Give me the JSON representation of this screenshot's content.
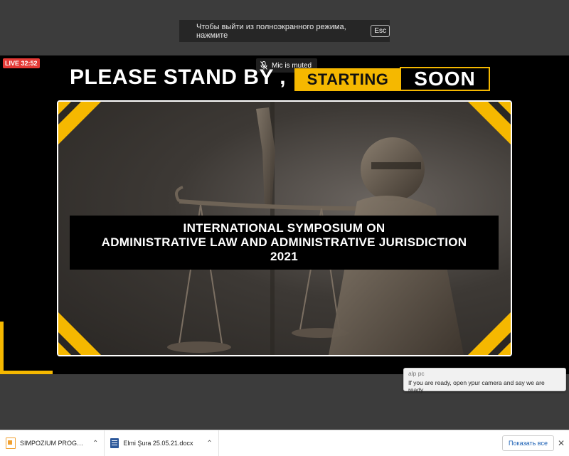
{
  "fullscreen_banner": {
    "text": "Чтобы выйти из полноэкранного режима, нажмите",
    "key": "Esc"
  },
  "stream": {
    "live_badge": "LIVE 32:52",
    "mic_status": "Mic is muted",
    "headline_left": "PLEASE STAND BY ,",
    "headline_starting": "STARTING",
    "headline_soon": "SOON",
    "title_lines": [
      "INTERNATIONAL SYMPOSIUM ON",
      "ADMINISTRATIVE LAW AND ADMINISTRATIVE JURISDICTION",
      "2021"
    ],
    "accent_color": "#f5b800"
  },
  "chat": {
    "author": "alp pc",
    "message": "If you are ready, open ypur camera and say we are ready"
  },
  "downloads": {
    "items": [
      {
        "name": "SIMPOZIUM PROG....pdf",
        "icon": "pdf-file-icon"
      },
      {
        "name": "Elmi Şura 25.05.21.docx",
        "icon": "word-file-icon"
      }
    ],
    "show_all": "Показать все"
  }
}
